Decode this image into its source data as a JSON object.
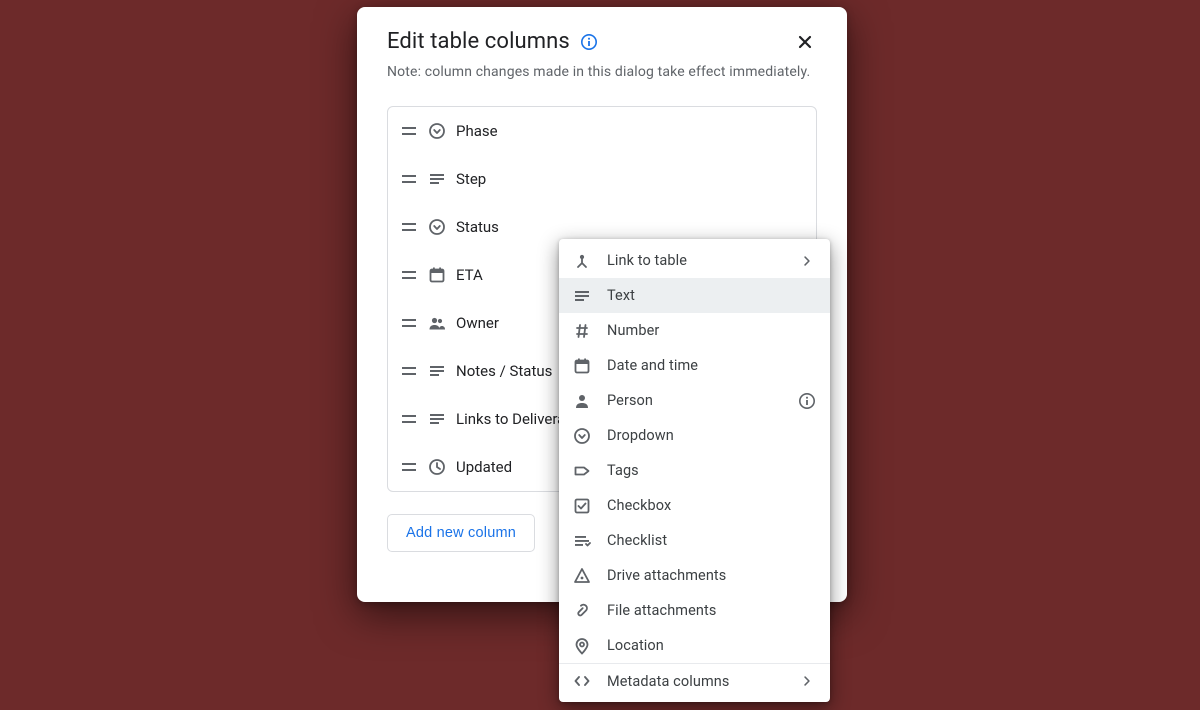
{
  "dialog": {
    "title": "Edit table columns",
    "note": "Note: column changes made in this dialog take effect immediately.",
    "add_button_label": "Add new column"
  },
  "columns": [
    {
      "label": "Phase",
      "type_icon": "dropdown"
    },
    {
      "label": "Step",
      "type_icon": "text"
    },
    {
      "label": "Status",
      "type_icon": "dropdown"
    },
    {
      "label": "ETA",
      "type_icon": "date"
    },
    {
      "label": "Owner",
      "type_icon": "person"
    },
    {
      "label": "Notes / Status",
      "type_icon": "text"
    },
    {
      "label": "Links to Deliverables",
      "type_icon": "text"
    },
    {
      "label": "Updated",
      "type_icon": "clock"
    }
  ],
  "menu": [
    {
      "label": "Link to table",
      "icon": "link-table",
      "submenu": true
    },
    {
      "label": "Text",
      "icon": "text",
      "selected": true
    },
    {
      "label": "Number",
      "icon": "number"
    },
    {
      "label": "Date and time",
      "icon": "date"
    },
    {
      "label": "Person",
      "icon": "person",
      "info": true
    },
    {
      "label": "Dropdown",
      "icon": "dropdown"
    },
    {
      "label": "Tags",
      "icon": "tag"
    },
    {
      "label": "Checkbox",
      "icon": "checkbox"
    },
    {
      "label": "Checklist",
      "icon": "checklist"
    },
    {
      "label": "Drive attachments",
      "icon": "drive"
    },
    {
      "label": "File attachments",
      "icon": "file"
    },
    {
      "label": "Location",
      "icon": "location"
    },
    {
      "label": "Metadata columns",
      "icon": "code",
      "submenu": true,
      "separator_before": true
    }
  ]
}
